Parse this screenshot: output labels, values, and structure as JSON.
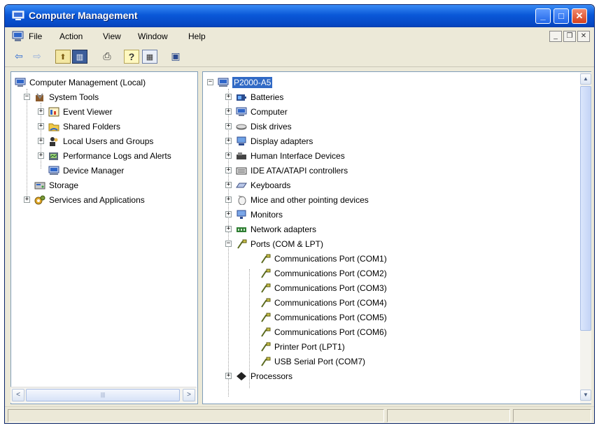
{
  "window": {
    "title": "Computer Management",
    "colors": {
      "titlebar": "#0a58d8",
      "selection": "#316ac5",
      "close": "#d5401c"
    }
  },
  "title_controls": {
    "minimize": "_",
    "maximize": "□",
    "close": "✕"
  },
  "menu": {
    "items": [
      {
        "label": "File"
      },
      {
        "label": "Action"
      },
      {
        "label": "View"
      },
      {
        "label": "Window"
      },
      {
        "label": "Help"
      }
    ],
    "mdi_controls": {
      "minimize": "_",
      "restore": "❐",
      "close": "✕"
    }
  },
  "toolbar": {
    "buttons": [
      {
        "name": "back-arrow-icon",
        "glyph": "⇦"
      },
      {
        "name": "forward-arrow-icon",
        "glyph": "⇨"
      },
      {
        "name": "up-folder-icon",
        "glyph": "⬆"
      },
      {
        "name": "show-hide-tree-icon",
        "glyph": "▥"
      },
      {
        "name": "print-icon",
        "glyph": "⎙"
      },
      {
        "name": "help-icon",
        "glyph": "?"
      },
      {
        "name": "properties-icon",
        "glyph": "▦"
      },
      {
        "name": "device-manager-icon",
        "glyph": "▣"
      }
    ]
  },
  "left_tree": {
    "root": "Computer Management (Local)",
    "items": [
      {
        "label": "System Tools",
        "icon": "tools-icon"
      },
      {
        "label": "Event Viewer",
        "icon": "event-viewer-icon"
      },
      {
        "label": "Shared Folders",
        "icon": "shared-folders-icon"
      },
      {
        "label": "Local Users and Groups",
        "icon": "users-icon"
      },
      {
        "label": "Performance Logs and Alerts",
        "icon": "performance-icon"
      },
      {
        "label": "Device Manager",
        "icon": "device-manager-icon"
      },
      {
        "label": "Storage",
        "icon": "storage-icon"
      },
      {
        "label": "Services and Applications",
        "icon": "services-icon"
      }
    ]
  },
  "right_tree": {
    "root": "P2000-A5",
    "categories": [
      {
        "label": "Batteries",
        "icon": "battery-icon"
      },
      {
        "label": "Computer",
        "icon": "computer-icon"
      },
      {
        "label": "Disk drives",
        "icon": "disk-drive-icon"
      },
      {
        "label": "Display adapters",
        "icon": "display-adapter-icon"
      },
      {
        "label": "Human Interface Devices",
        "icon": "hid-icon"
      },
      {
        "label": "IDE ATA/ATAPI controllers",
        "icon": "ide-controller-icon"
      },
      {
        "label": "Keyboards",
        "icon": "keyboard-icon"
      },
      {
        "label": "Mice and other pointing devices",
        "icon": "mouse-icon"
      },
      {
        "label": "Monitors",
        "icon": "monitor-icon"
      },
      {
        "label": "Network adapters",
        "icon": "network-adapter-icon"
      },
      {
        "label": "Ports (COM & LPT)",
        "icon": "port-icon"
      }
    ],
    "ports": [
      "Communications Port (COM1)",
      "Communications Port (COM2)",
      "Communications Port (COM3)",
      "Communications Port (COM4)",
      "Communications Port (COM5)",
      "Communications Port (COM6)",
      "Printer Port (LPT1)",
      "USB Serial Port (COM7)"
    ],
    "after_ports": [
      {
        "label": "Processors",
        "icon": "processor-icon"
      }
    ]
  },
  "scrollbars": {
    "left_horizontal": {
      "left_arrow": "<",
      "right_arrow": ">",
      "grip": "|||"
    },
    "right_vertical": {
      "up_arrow": "▲",
      "down_arrow": "▼"
    }
  }
}
